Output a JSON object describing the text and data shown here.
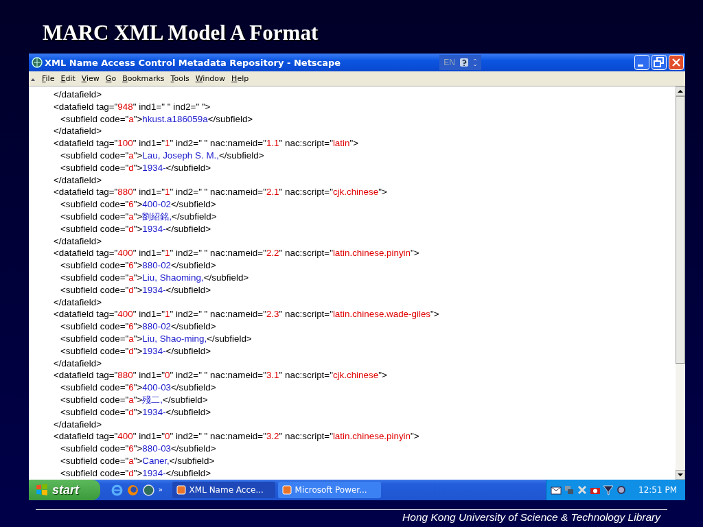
{
  "slide_title": "MARC XML Model A Format",
  "window": {
    "title": "XML Name Access Control Metadata Repository - Netscape",
    "language": "EN"
  },
  "menu": [
    "File",
    "Edit",
    "View",
    "Go",
    "Bookmarks",
    "Tools",
    "Window",
    "Help"
  ],
  "document": {
    "lines": [
      {
        "kind": "datafield",
        "parts": [
          {
            "text": "</datafield>",
            "kind": "markup"
          }
        ]
      },
      {
        "kind": "datafield",
        "parts": [
          {
            "text": "<datafield tag=\"",
            "kind": "markup"
          },
          {
            "text": "948",
            "kind": "value"
          },
          {
            "text": "\" ind1=\" \" ind2=\" \">",
            "kind": "markup"
          }
        ]
      },
      {
        "kind": "subfield",
        "parts": [
          {
            "text": "<subfield code=\"",
            "kind": "markup"
          },
          {
            "text": "a",
            "kind": "value"
          },
          {
            "text": "\">",
            "kind": "markup"
          },
          {
            "text": "hkust.a186059a",
            "kind": "content"
          },
          {
            "text": "</subfield>",
            "kind": "markup"
          }
        ]
      },
      {
        "kind": "datafield",
        "parts": [
          {
            "text": "</datafield>",
            "kind": "markup"
          }
        ]
      },
      {
        "kind": "datafield",
        "parts": [
          {
            "text": "<datafield tag=\"",
            "kind": "markup"
          },
          {
            "text": "100",
            "kind": "value"
          },
          {
            "text": "\" ind1=\"",
            "kind": "markup"
          },
          {
            "text": "1",
            "kind": "value"
          },
          {
            "text": "\" ind2=\" \" nac:nameid=\"",
            "kind": "markup"
          },
          {
            "text": "1.1",
            "kind": "value"
          },
          {
            "text": "\" nac:script=\"",
            "kind": "markup"
          },
          {
            "text": "latin",
            "kind": "value"
          },
          {
            "text": "\">",
            "kind": "markup"
          }
        ]
      },
      {
        "kind": "subfield",
        "parts": [
          {
            "text": "<subfield code=\"",
            "kind": "markup"
          },
          {
            "text": "a",
            "kind": "value"
          },
          {
            "text": "\">",
            "kind": "markup"
          },
          {
            "text": "Lau, Joseph S. M.,",
            "kind": "content"
          },
          {
            "text": "</subfield>",
            "kind": "markup"
          }
        ]
      },
      {
        "kind": "subfield",
        "parts": [
          {
            "text": "<subfield code=\"",
            "kind": "markup"
          },
          {
            "text": "d",
            "kind": "value"
          },
          {
            "text": "\">",
            "kind": "markup"
          },
          {
            "text": "1934-",
            "kind": "content"
          },
          {
            "text": "</subfield>",
            "kind": "markup"
          }
        ]
      },
      {
        "kind": "datafield",
        "parts": [
          {
            "text": "</datafield>",
            "kind": "markup"
          }
        ]
      },
      {
        "kind": "datafield",
        "parts": [
          {
            "text": "<datafield tag=\"",
            "kind": "markup"
          },
          {
            "text": "880",
            "kind": "value"
          },
          {
            "text": "\" ind1=\"",
            "kind": "markup"
          },
          {
            "text": "1",
            "kind": "value"
          },
          {
            "text": "\" ind2=\" \" nac:nameid=\"",
            "kind": "markup"
          },
          {
            "text": "2.1",
            "kind": "value"
          },
          {
            "text": "\" nac:script=\"",
            "kind": "markup"
          },
          {
            "text": "cjk.chinese",
            "kind": "value"
          },
          {
            "text": "\">",
            "kind": "markup"
          }
        ]
      },
      {
        "kind": "subfield",
        "parts": [
          {
            "text": "<subfield code=\"",
            "kind": "markup"
          },
          {
            "text": "6",
            "kind": "value"
          },
          {
            "text": "\">",
            "kind": "markup"
          },
          {
            "text": "400-02",
            "kind": "content"
          },
          {
            "text": "</subfield>",
            "kind": "markup"
          }
        ]
      },
      {
        "kind": "subfield",
        "parts": [
          {
            "text": "<subfield code=\"",
            "kind": "markup"
          },
          {
            "text": "a",
            "kind": "value"
          },
          {
            "text": "\">",
            "kind": "markup"
          },
          {
            "text": "劉紹銘,",
            "kind": "content"
          },
          {
            "text": "</subfield>",
            "kind": "markup"
          }
        ]
      },
      {
        "kind": "subfield",
        "parts": [
          {
            "text": "<subfield code=\"",
            "kind": "markup"
          },
          {
            "text": "d",
            "kind": "value"
          },
          {
            "text": "\">",
            "kind": "markup"
          },
          {
            "text": "1934-",
            "kind": "content"
          },
          {
            "text": "</subfield>",
            "kind": "markup"
          }
        ]
      },
      {
        "kind": "datafield",
        "parts": [
          {
            "text": "</datafield>",
            "kind": "markup"
          }
        ]
      },
      {
        "kind": "datafield",
        "parts": [
          {
            "text": "<datafield tag=\"",
            "kind": "markup"
          },
          {
            "text": "400",
            "kind": "value"
          },
          {
            "text": "\" ind1=\"",
            "kind": "markup"
          },
          {
            "text": "1",
            "kind": "value"
          },
          {
            "text": "\" ind2=\" \" nac:nameid=\"",
            "kind": "markup"
          },
          {
            "text": "2.2",
            "kind": "value"
          },
          {
            "text": "\" nac:script=\"",
            "kind": "markup"
          },
          {
            "text": "latin.chinese.pinyin",
            "kind": "value"
          },
          {
            "text": "\">",
            "kind": "markup"
          }
        ]
      },
      {
        "kind": "subfield",
        "parts": [
          {
            "text": "<subfield code=\"",
            "kind": "markup"
          },
          {
            "text": "6",
            "kind": "value"
          },
          {
            "text": "\">",
            "kind": "markup"
          },
          {
            "text": "880-02",
            "kind": "content"
          },
          {
            "text": "</subfield>",
            "kind": "markup"
          }
        ]
      },
      {
        "kind": "subfield",
        "parts": [
          {
            "text": "<subfield code=\"",
            "kind": "markup"
          },
          {
            "text": "a",
            "kind": "value"
          },
          {
            "text": "\">",
            "kind": "markup"
          },
          {
            "text": "Liu, Shaoming,",
            "kind": "content"
          },
          {
            "text": "</subfield>",
            "kind": "markup"
          }
        ]
      },
      {
        "kind": "subfield",
        "parts": [
          {
            "text": "<subfield code=\"",
            "kind": "markup"
          },
          {
            "text": "d",
            "kind": "value"
          },
          {
            "text": "\">",
            "kind": "markup"
          },
          {
            "text": "1934-",
            "kind": "content"
          },
          {
            "text": "</subfield>",
            "kind": "markup"
          }
        ]
      },
      {
        "kind": "datafield",
        "parts": [
          {
            "text": "</datafield>",
            "kind": "markup"
          }
        ]
      },
      {
        "kind": "datafield",
        "parts": [
          {
            "text": "<datafield tag=\"",
            "kind": "markup"
          },
          {
            "text": "400",
            "kind": "value"
          },
          {
            "text": "\" ind1=\"",
            "kind": "markup"
          },
          {
            "text": "1",
            "kind": "value"
          },
          {
            "text": "\" ind2=\" \" nac:nameid=\"",
            "kind": "markup"
          },
          {
            "text": "2.3",
            "kind": "value"
          },
          {
            "text": "\" nac:script=\"",
            "kind": "markup"
          },
          {
            "text": "latin.chinese.wade-giles",
            "kind": "value"
          },
          {
            "text": "\">",
            "kind": "markup"
          }
        ]
      },
      {
        "kind": "subfield",
        "parts": [
          {
            "text": "<subfield code=\"",
            "kind": "markup"
          },
          {
            "text": "6",
            "kind": "value"
          },
          {
            "text": "\">",
            "kind": "markup"
          },
          {
            "text": "880-02",
            "kind": "content"
          },
          {
            "text": "</subfield>",
            "kind": "markup"
          }
        ]
      },
      {
        "kind": "subfield",
        "parts": [
          {
            "text": "<subfield code=\"",
            "kind": "markup"
          },
          {
            "text": "a",
            "kind": "value"
          },
          {
            "text": "\">",
            "kind": "markup"
          },
          {
            "text": "Liu, Shao-ming,",
            "kind": "content"
          },
          {
            "text": "</subfield>",
            "kind": "markup"
          }
        ]
      },
      {
        "kind": "subfield",
        "parts": [
          {
            "text": "<subfield code=\"",
            "kind": "markup"
          },
          {
            "text": "d",
            "kind": "value"
          },
          {
            "text": "\">",
            "kind": "markup"
          },
          {
            "text": "1934-",
            "kind": "content"
          },
          {
            "text": "</subfield>",
            "kind": "markup"
          }
        ]
      },
      {
        "kind": "datafield",
        "parts": [
          {
            "text": "</datafield>",
            "kind": "markup"
          }
        ]
      },
      {
        "kind": "datafield",
        "parts": [
          {
            "text": "<datafield tag=\"",
            "kind": "markup"
          },
          {
            "text": "880",
            "kind": "value"
          },
          {
            "text": "\" ind1=\"",
            "kind": "markup"
          },
          {
            "text": "0",
            "kind": "value"
          },
          {
            "text": "\" ind2=\" \" nac:nameid=\"",
            "kind": "markup"
          },
          {
            "text": "3.1",
            "kind": "value"
          },
          {
            "text": "\" nac:script=\"",
            "kind": "markup"
          },
          {
            "text": "cjk.chinese",
            "kind": "value"
          },
          {
            "text": "\">",
            "kind": "markup"
          }
        ]
      },
      {
        "kind": "subfield",
        "parts": [
          {
            "text": "<subfield code=\"",
            "kind": "markup"
          },
          {
            "text": "6",
            "kind": "value"
          },
          {
            "text": "\">",
            "kind": "markup"
          },
          {
            "text": "400-03",
            "kind": "content"
          },
          {
            "text": "</subfield>",
            "kind": "markup"
          }
        ]
      },
      {
        "kind": "subfield",
        "parts": [
          {
            "text": "<subfield code=\"",
            "kind": "markup"
          },
          {
            "text": "a",
            "kind": "value"
          },
          {
            "text": "\">",
            "kind": "markup"
          },
          {
            "text": "殘二,",
            "kind": "content"
          },
          {
            "text": "</subfield>",
            "kind": "markup"
          }
        ]
      },
      {
        "kind": "subfield",
        "parts": [
          {
            "text": "<subfield code=\"",
            "kind": "markup"
          },
          {
            "text": "d",
            "kind": "value"
          },
          {
            "text": "\">",
            "kind": "markup"
          },
          {
            "text": "1934-",
            "kind": "content"
          },
          {
            "text": "</subfield>",
            "kind": "markup"
          }
        ]
      },
      {
        "kind": "datafield",
        "parts": [
          {
            "text": "</datafield>",
            "kind": "markup"
          }
        ]
      },
      {
        "kind": "datafield",
        "parts": [
          {
            "text": "<datafield tag=\"",
            "kind": "markup"
          },
          {
            "text": "400",
            "kind": "value"
          },
          {
            "text": "\" ind1=\"",
            "kind": "markup"
          },
          {
            "text": "0",
            "kind": "value"
          },
          {
            "text": "\" ind2=\" \" nac:nameid=\"",
            "kind": "markup"
          },
          {
            "text": "3.2",
            "kind": "value"
          },
          {
            "text": "\" nac:script=\"",
            "kind": "markup"
          },
          {
            "text": "latin.chinese.pinyin",
            "kind": "value"
          },
          {
            "text": "\">",
            "kind": "markup"
          }
        ]
      },
      {
        "kind": "subfield",
        "parts": [
          {
            "text": "<subfield code=\"",
            "kind": "markup"
          },
          {
            "text": "6",
            "kind": "value"
          },
          {
            "text": "\">",
            "kind": "markup"
          },
          {
            "text": "880-03",
            "kind": "content"
          },
          {
            "text": "</subfield>",
            "kind": "markup"
          }
        ]
      },
      {
        "kind": "subfield",
        "parts": [
          {
            "text": "<subfield code=\"",
            "kind": "markup"
          },
          {
            "text": "a",
            "kind": "value"
          },
          {
            "text": "\">",
            "kind": "markup"
          },
          {
            "text": "Caner,",
            "kind": "content"
          },
          {
            "text": "</subfield>",
            "kind": "markup"
          }
        ]
      },
      {
        "kind": "subfield",
        "parts": [
          {
            "text": "<subfield code=\"",
            "kind": "markup"
          },
          {
            "text": "d",
            "kind": "value"
          },
          {
            "text": "\">",
            "kind": "markup"
          },
          {
            "text": "1934-",
            "kind": "content"
          },
          {
            "text": "</subfield>",
            "kind": "markup"
          }
        ]
      }
    ]
  },
  "taskbar": {
    "start": "start",
    "quick_launch_more": "»",
    "tasks": [
      {
        "label": "XML Name Acce...",
        "selected": true
      },
      {
        "label": "Microsoft Power...",
        "selected": false
      }
    ],
    "clock": "12:51 PM"
  },
  "footer": "Hong Kong University of Science & Technology Library"
}
